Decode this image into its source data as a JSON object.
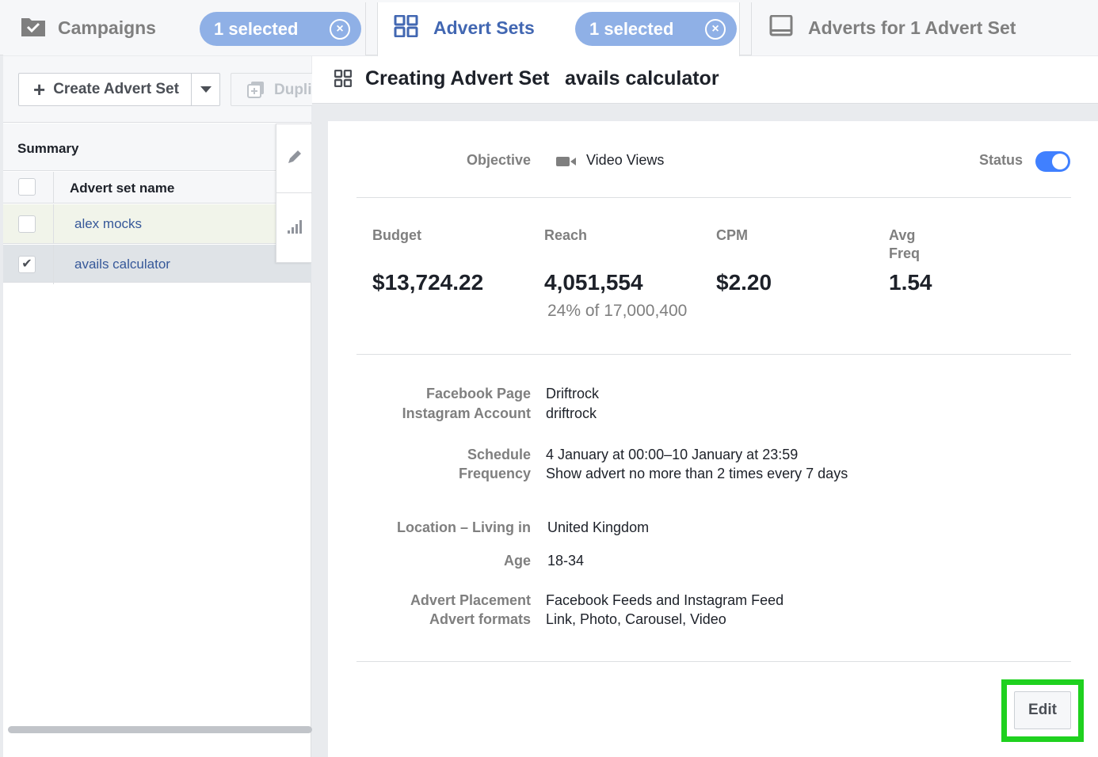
{
  "tabs": {
    "campaigns": {
      "label": "Campaigns",
      "selected": "1 selected"
    },
    "adsets": {
      "label": "Advert Sets",
      "selected": "1 selected"
    },
    "adverts": {
      "label": "Adverts for 1 Advert Set"
    }
  },
  "toolbar": {
    "create_label": "Create Advert Set",
    "duplicate_label": "Duplicate"
  },
  "table": {
    "summary_label": "Summary",
    "column_header": "Advert set name",
    "rows": [
      {
        "name": "alex mocks",
        "checked": false
      },
      {
        "name": "avails calculator",
        "checked": true
      }
    ]
  },
  "detail": {
    "header_title": "Creating Advert Set",
    "header_name": "avails calculator",
    "objective_label": "Objective",
    "objective_value": "Video Views",
    "status_label": "Status",
    "status_on": true,
    "metrics": {
      "budget": {
        "label": "Budget",
        "value": "$13,724.22"
      },
      "reach": {
        "label": "Reach",
        "value": "4,051,554",
        "sub": "24% of 17,000,400"
      },
      "cpm": {
        "label": "CPM",
        "value": "$2.20"
      },
      "freq": {
        "label_line1": "Avg",
        "label_line2": "Freq",
        "value": "1.54"
      }
    },
    "fields": {
      "facebook_page": {
        "label": "Facebook Page",
        "value": "Driftrock"
      },
      "instagram_account": {
        "label": "Instagram Account",
        "value": "driftrock"
      },
      "schedule": {
        "label": "Schedule",
        "value": "4 January at 00:00–10 January at 23:59"
      },
      "frequency": {
        "label": "Frequency",
        "value": "Show advert no more than 2 times every 7 days"
      },
      "location": {
        "label": "Location – Living in",
        "value": "United Kingdom"
      },
      "age": {
        "label": "Age",
        "value": "18-34"
      },
      "placement": {
        "label": "Advert Placement",
        "value": "Facebook Feeds and Instagram Feed"
      },
      "formats": {
        "label": "Advert formats",
        "value": "Link, Photo, Carousel, Video"
      }
    },
    "edit_label": "Edit"
  },
  "colors": {
    "accent": "#4267b2",
    "toggle": "#4080ff",
    "highlight": "#1fd11f"
  }
}
